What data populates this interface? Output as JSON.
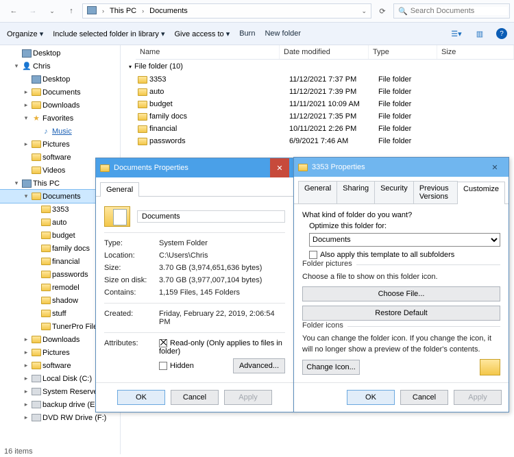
{
  "nav": {
    "back": "←",
    "fwd": "→",
    "up": "↑",
    "refresh": "⟳",
    "breadcrumb": [
      "This PC",
      "Documents"
    ],
    "search_placeholder": "Search Documents"
  },
  "toolbar": {
    "organize": "Organize",
    "include": "Include selected folder in library",
    "give": "Give access to",
    "burn": "Burn",
    "newf": "New folder"
  },
  "tree": [
    {
      "d": 1,
      "exp": "",
      "icon": "pc",
      "label": "Desktop"
    },
    {
      "d": 1,
      "exp": "-",
      "icon": "user",
      "label": "Chris"
    },
    {
      "d": 2,
      "exp": "",
      "icon": "pc",
      "label": "Desktop"
    },
    {
      "d": 2,
      "exp": "+",
      "icon": "folder",
      "label": "Documents"
    },
    {
      "d": 2,
      "exp": "+",
      "icon": "folder",
      "label": "Downloads"
    },
    {
      "d": 2,
      "exp": "-",
      "icon": "star",
      "label": "Favorites"
    },
    {
      "d": 3,
      "exp": "",
      "icon": "link",
      "label": "Music",
      "link": true
    },
    {
      "d": 2,
      "exp": "+",
      "icon": "folder",
      "label": "Pictures"
    },
    {
      "d": 2,
      "exp": "",
      "icon": "folder",
      "label": "software"
    },
    {
      "d": 2,
      "exp": "",
      "icon": "folder",
      "label": "Videos"
    },
    {
      "d": 1,
      "exp": "-",
      "icon": "pc",
      "label": "This PC"
    },
    {
      "d": 2,
      "exp": "-",
      "icon": "folder",
      "label": "Documents",
      "sel": true
    },
    {
      "d": 3,
      "exp": "",
      "icon": "folder",
      "label": "3353"
    },
    {
      "d": 3,
      "exp": "",
      "icon": "folder",
      "label": "auto"
    },
    {
      "d": 3,
      "exp": "",
      "icon": "folder",
      "label": "budget"
    },
    {
      "d": 3,
      "exp": "",
      "icon": "folder",
      "label": "family docs"
    },
    {
      "d": 3,
      "exp": "",
      "icon": "folder",
      "label": "financial"
    },
    {
      "d": 3,
      "exp": "",
      "icon": "folder",
      "label": "passwords"
    },
    {
      "d": 3,
      "exp": "",
      "icon": "folder",
      "label": "remodel"
    },
    {
      "d": 3,
      "exp": "",
      "icon": "folder",
      "label": "shadow"
    },
    {
      "d": 3,
      "exp": "",
      "icon": "folder",
      "label": "stuff"
    },
    {
      "d": 3,
      "exp": "",
      "icon": "folder",
      "label": "TunerPro Files"
    },
    {
      "d": 2,
      "exp": "+",
      "icon": "folder",
      "label": "Downloads"
    },
    {
      "d": 2,
      "exp": "+",
      "icon": "folder",
      "label": "Pictures"
    },
    {
      "d": 2,
      "exp": "+",
      "icon": "folder",
      "label": "software"
    },
    {
      "d": 2,
      "exp": "+",
      "icon": "drive",
      "label": "Local Disk (C:)"
    },
    {
      "d": 2,
      "exp": "+",
      "icon": "drive",
      "label": "System Reserved (D:)"
    },
    {
      "d": 2,
      "exp": "+",
      "icon": "drive",
      "label": "backup drive (E:)"
    },
    {
      "d": 2,
      "exp": "+",
      "icon": "drive",
      "label": "DVD RW Drive (F:)"
    }
  ],
  "list": {
    "headers": {
      "name": "Name",
      "date": "Date modified",
      "type": "Type",
      "size": "Size"
    },
    "group": "File folder (10)",
    "rows": [
      {
        "name": "3353",
        "date": "11/12/2021 7:37 PM",
        "type": "File folder"
      },
      {
        "name": "auto",
        "date": "11/12/2021 7:39 PM",
        "type": "File folder"
      },
      {
        "name": "budget",
        "date": "11/11/2021 10:09 AM",
        "type": "File folder"
      },
      {
        "name": "family docs",
        "date": "11/12/2021 7:35 PM",
        "type": "File folder"
      },
      {
        "name": "financial",
        "date": "10/11/2021 2:26 PM",
        "type": "File folder"
      },
      {
        "name": "passwords",
        "date": "6/9/2021 7:46 AM",
        "type": "File folder"
      }
    ]
  },
  "status": "16 items",
  "dlg1": {
    "title": "Documents Properties",
    "tab": "General",
    "name_value": "Documents",
    "type_k": "Type:",
    "type_v": "System Folder",
    "loc_k": "Location:",
    "loc_v": "C:\\Users\\Chris",
    "size_k": "Size:",
    "size_v": "3.70 GB (3,974,651,636 bytes)",
    "disk_k": "Size on disk:",
    "disk_v": "3.70 GB (3,977,007,104 bytes)",
    "cont_k": "Contains:",
    "cont_v": "1,159 Files, 145 Folders",
    "created_k": "Created:",
    "created_v": "Friday, February 22, 2019, 2:06:54 PM",
    "attr_k": "Attributes:",
    "readonly": "Read-only (Only applies to files in folder)",
    "hidden": "Hidden",
    "advanced": "Advanced...",
    "ok": "OK",
    "cancel": "Cancel",
    "apply": "Apply"
  },
  "dlg2": {
    "title": "3353 Properties",
    "tabs": [
      "General",
      "Sharing",
      "Security",
      "Previous Versions",
      "Customize"
    ],
    "active_tab": "Customize",
    "q": "What kind of folder do you want?",
    "opt_lbl": "Optimize this folder for:",
    "opt_value": "Documents",
    "also": "Also apply this template to all subfolders",
    "pic_legend": "Folder pictures",
    "pic_note": "Choose a file to show on this folder icon.",
    "choose": "Choose File...",
    "restore": "Restore Default",
    "ico_legend": "Folder icons",
    "ico_note": "You can change the folder icon. If you change the icon, it will no longer show a preview of the folder's contents.",
    "change": "Change Icon...",
    "ok": "OK",
    "cancel": "Cancel",
    "apply": "Apply"
  }
}
